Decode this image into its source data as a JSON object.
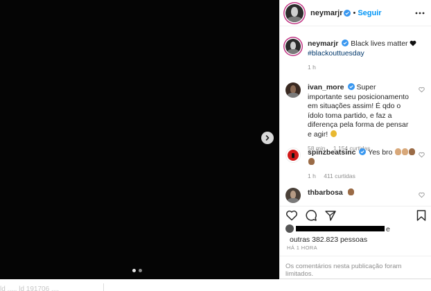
{
  "post": {
    "account": {
      "username": "neymarjr",
      "follow_label": "Seguir",
      "separator": "•"
    },
    "carousel": {
      "slide_count": 2,
      "active_slide": 1
    },
    "caption": {
      "username": "neymarjr",
      "text": "Black lives matter",
      "hashtag": "#blackouttuesday",
      "time": "1 h"
    },
    "comments": [
      {
        "username": "ivan_more",
        "text": "Super importante seu posicionamento em situações assim! É qdo o ídolo toma partido, e faz a diferença pela forma de pensar e agir!",
        "time": "58 min",
        "likes": "1.154 curtidas"
      },
      {
        "username": "spinzbeatsinc",
        "text": "Yes bro",
        "time": "1 h",
        "likes": "411 curtidas"
      },
      {
        "username": "thbarbosa",
        "text": ""
      }
    ],
    "likes": {
      "conjunction": "e",
      "others_text": "outras 382.823 pessoas"
    },
    "timestamp": "HÁ 1 HORA",
    "comments_limited": "Os comentários nesta publicação foram limitados."
  },
  "below_bar": {
    "text": "ld ..... ld 191706 ...."
  },
  "colors": {
    "accent": "#0095f6",
    "media_bg": "#050505",
    "muted": "#8e8e8e",
    "hashtag": "#00376b"
  }
}
